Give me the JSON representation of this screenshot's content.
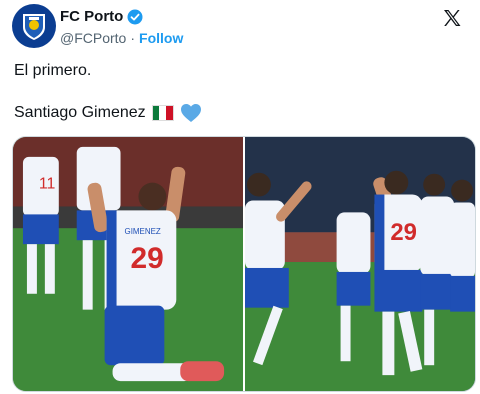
{
  "account": {
    "display_name": "FC Porto",
    "handle": "@FCPorto",
    "separator": "·",
    "follow_label": "Follow"
  },
  "post": {
    "line1": "El primero.",
    "line2": "Santiago Gimenez"
  },
  "media": {
    "photo1_jersey_name": "GIMENEZ",
    "photo1_jersey_number": "29",
    "photo1_bg_player_number": "11",
    "photo2_jersey_number": "29"
  },
  "colors": {
    "brand_blue": "#0b3d91",
    "link_blue": "#1d9bf0",
    "verified_blue": "#1d9bf0",
    "heart_blue": "#5aa9e6"
  }
}
